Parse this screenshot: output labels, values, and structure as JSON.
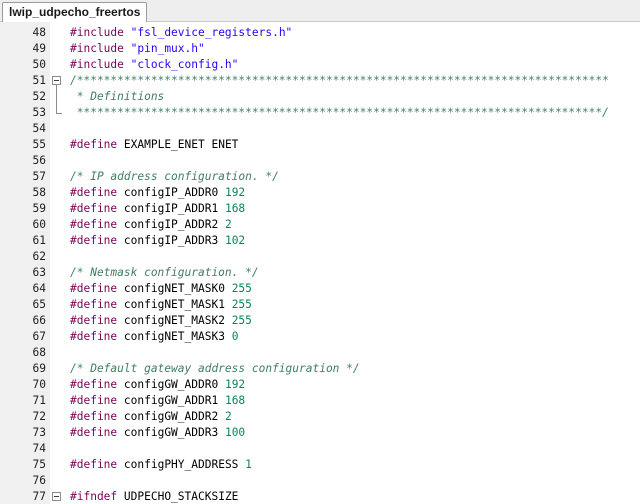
{
  "tab": {
    "title": "lwip_udpecho_freertos"
  },
  "colors": {
    "directive": "#7f0055",
    "string": "#2a00ff",
    "number": "#098658",
    "comment": "#3f7f5f"
  },
  "lines": [
    {
      "n": "48",
      "directive": "#include",
      "sp": " ",
      "str": "\"fsl_device_registers.h\""
    },
    {
      "n": "49",
      "directive": "#include",
      "sp": " ",
      "str": "\"pin_mux.h\""
    },
    {
      "n": "50",
      "directive": "#include",
      "sp": " ",
      "str": "\"clock_config.h\""
    },
    {
      "n": "51",
      "comment": "/*******************************************************************************",
      "fold": true
    },
    {
      "n": "52",
      "comment": " * Definitions"
    },
    {
      "n": "53",
      "comment": " ******************************************************************************/"
    },
    {
      "n": "54"
    },
    {
      "n": "55",
      "directive": "#define",
      "sp": " ",
      "ident": "EXAMPLE_ENET ENET"
    },
    {
      "n": "56"
    },
    {
      "n": "57",
      "comment": "/* IP address configuration. */"
    },
    {
      "n": "58",
      "directive": "#define",
      "sp": " ",
      "ident": "configIP_ADDR0 ",
      "num": "192"
    },
    {
      "n": "59",
      "directive": "#define",
      "sp": " ",
      "ident": "configIP_ADDR1 ",
      "num": "168"
    },
    {
      "n": "60",
      "directive": "#define",
      "sp": " ",
      "ident": "configIP_ADDR2 ",
      "num": "2"
    },
    {
      "n": "61",
      "directive": "#define",
      "sp": " ",
      "ident": "configIP_ADDR3 ",
      "num": "102"
    },
    {
      "n": "62"
    },
    {
      "n": "63",
      "comment": "/* Netmask configuration. */"
    },
    {
      "n": "64",
      "directive": "#define",
      "sp": " ",
      "ident": "configNET_MASK0 ",
      "num": "255"
    },
    {
      "n": "65",
      "directive": "#define",
      "sp": " ",
      "ident": "configNET_MASK1 ",
      "num": "255"
    },
    {
      "n": "66",
      "directive": "#define",
      "sp": " ",
      "ident": "configNET_MASK2 ",
      "num": "255"
    },
    {
      "n": "67",
      "directive": "#define",
      "sp": " ",
      "ident": "configNET_MASK3 ",
      "num": "0"
    },
    {
      "n": "68"
    },
    {
      "n": "69",
      "comment": "/* Default gateway address configuration */"
    },
    {
      "n": "70",
      "directive": "#define",
      "sp": " ",
      "ident": "configGW_ADDR0 ",
      "num": "192"
    },
    {
      "n": "71",
      "directive": "#define",
      "sp": " ",
      "ident": "configGW_ADDR1 ",
      "num": "168"
    },
    {
      "n": "72",
      "directive": "#define",
      "sp": " ",
      "ident": "configGW_ADDR2 ",
      "num": "2"
    },
    {
      "n": "73",
      "directive": "#define",
      "sp": " ",
      "ident": "configGW_ADDR3 ",
      "num": "100"
    },
    {
      "n": "74"
    },
    {
      "n": "75",
      "directive": "#define",
      "sp": " ",
      "ident": "configPHY_ADDRESS ",
      "num": "1"
    },
    {
      "n": "76"
    },
    {
      "n": "77",
      "directive": "#ifndef",
      "sp": " ",
      "ident": "UDPECHO_STACKSIZE",
      "fold": true
    }
  ]
}
